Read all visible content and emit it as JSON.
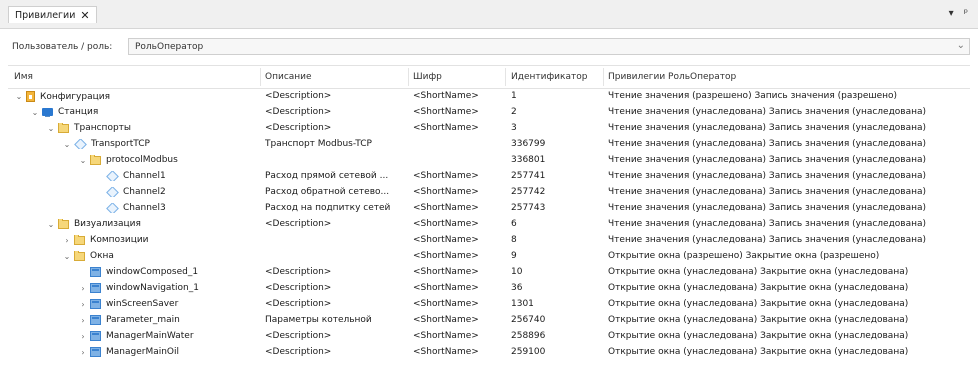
{
  "tab": {
    "title": "Привилегии",
    "close": "✕"
  },
  "tab_tools": {
    "dropdown": "▾",
    "pin": "ᵖ"
  },
  "userbar": {
    "label": "Пользователь / роль:",
    "value": "РольОператор",
    "arrow": "⌄"
  },
  "columns": [
    "Имя",
    "Описание",
    "Шифр",
    "Идентификатор",
    "Привилегии РольОператор"
  ],
  "rows": [
    {
      "name": "Конфигурация",
      "level": 0,
      "expand": "expanded",
      "icon": "config-icon",
      "description": "<Description>",
      "code": "<ShortName>",
      "id": "1",
      "privileges": "Чтение значения (разрешено) Запись значения (разрешено)"
    },
    {
      "name": "Станция",
      "level": 1,
      "expand": "expanded",
      "icon": "station-icon",
      "description": "<Description>",
      "code": "<ShortName>",
      "id": "2",
      "privileges": "Чтение значения (унаследована) Запись значения (унаследована)"
    },
    {
      "name": "Транспорты",
      "level": 2,
      "expand": "expanded",
      "icon": "folder-icon",
      "description": "<Description>",
      "code": "<ShortName>",
      "id": "3",
      "privileges": "Чтение значения (унаследована) Запись значения (унаследована)"
    },
    {
      "name": "TransportTCP",
      "level": 3,
      "expand": "expanded",
      "icon": "node-icon",
      "description": "Транспорт Modbus-TCP",
      "code": "",
      "id": "336799",
      "privileges": "Чтение значения (унаследована) Запись значения (унаследована)"
    },
    {
      "name": "protocolModbus",
      "level": 4,
      "expand": "expanded",
      "icon": "folder-icon",
      "description": "",
      "code": "",
      "id": "336801",
      "privileges": "Чтение значения (унаследована) Запись значения (унаследована)"
    },
    {
      "name": "Channel1",
      "level": 5,
      "expand": "none",
      "icon": "node-icon",
      "description": "Расход прямой сетевой ...",
      "code": "<ShortName>",
      "id": "257741",
      "privileges": "Чтение значения (унаследована) Запись значения (унаследована)"
    },
    {
      "name": "Channel2",
      "level": 5,
      "expand": "none",
      "icon": "node-icon",
      "description": "Расход обратной сетево...",
      "code": "<ShortName>",
      "id": "257742",
      "privileges": "Чтение значения (унаследована) Запись значения (унаследована)"
    },
    {
      "name": "Channel3",
      "level": 5,
      "expand": "none",
      "icon": "node-icon",
      "description": "Расход на подпитку сетей",
      "code": "<ShortName>",
      "id": "257743",
      "privileges": "Чтение значения (унаследована) Запись значения (унаследована)"
    },
    {
      "name": "Визуализация",
      "level": 2,
      "expand": "expanded",
      "icon": "folder-icon",
      "description": "<Description>",
      "code": "<ShortName>",
      "id": "6",
      "privileges": "Чтение значения (унаследована) Запись значения (унаследована)"
    },
    {
      "name": "Композиции",
      "level": 3,
      "expand": "collapsed",
      "icon": "folder-icon",
      "description": "",
      "code": "<ShortName>",
      "id": "8",
      "privileges": "Чтение значения (унаследована) Запись значения (унаследована)"
    },
    {
      "name": "Окна",
      "level": 3,
      "expand": "expanded",
      "icon": "folder-icon",
      "description": "",
      "code": "<ShortName>",
      "id": "9",
      "privileges": "Открытие окна (разрешено) Закрытие окна (разрешено)"
    },
    {
      "name": "windowComposed_1",
      "level": 4,
      "expand": "none",
      "icon": "window-icon",
      "description": "<Description>",
      "code": "<ShortName>",
      "id": "10",
      "privileges": "Открытие окна (унаследована) Закрытие окна (унаследована)"
    },
    {
      "name": "windowNavigation_1",
      "level": 4,
      "expand": "collapsed",
      "icon": "window-icon",
      "description": "<Description>",
      "code": "<ShortName>",
      "id": "36",
      "privileges": "Открытие окна (унаследована) Закрытие окна (унаследована)"
    },
    {
      "name": "winScreenSaver",
      "level": 4,
      "expand": "collapsed",
      "icon": "window-icon",
      "description": "<Description>",
      "code": "<ShortName>",
      "id": "1301",
      "privileges": "Открытие окна (унаследована) Закрытие окна (унаследована)"
    },
    {
      "name": "Parameter_main",
      "level": 4,
      "expand": "collapsed",
      "icon": "window-icon",
      "description": "Параметры котельной",
      "code": "<ShortName>",
      "id": "256740",
      "privileges": "Открытие окна (унаследована) Закрытие окна (унаследована)"
    },
    {
      "name": "ManagerMainWater",
      "level": 4,
      "expand": "collapsed",
      "icon": "window-icon",
      "description": "<Description>",
      "code": "<ShortName>",
      "id": "258896",
      "privileges": "Открытие окна (унаследована) Закрытие окна (унаследована)"
    },
    {
      "name": "ManagerMainOil",
      "level": 4,
      "expand": "collapsed",
      "icon": "window-icon",
      "description": "<Description>",
      "code": "<ShortName>",
      "id": "259100",
      "privileges": "Открытие окна (унаследована) Закрытие окна (унаследована)"
    }
  ]
}
